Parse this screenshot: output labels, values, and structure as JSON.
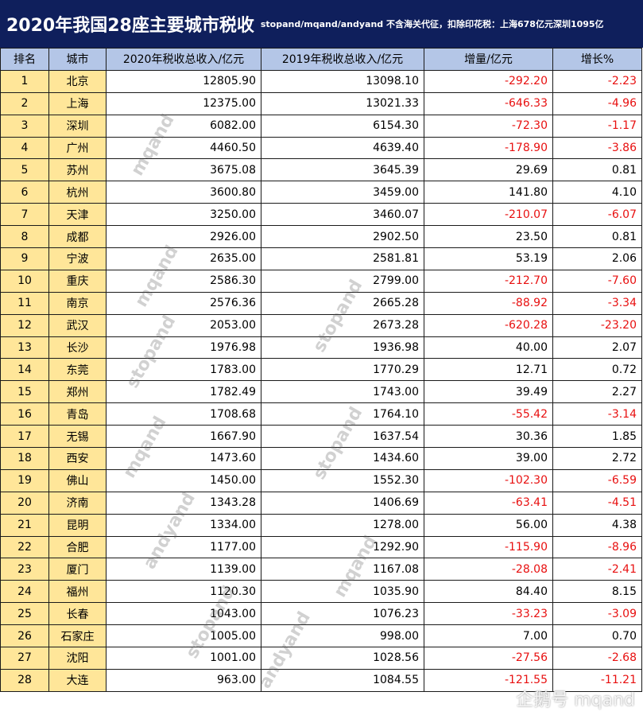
{
  "header": {
    "title": "2020年我国28座主要城市税收",
    "subtitle": "stopand/mqand/andyand 不含海关代征，扣除印花税：上海678亿元深圳1095亿"
  },
  "columns": [
    "排名",
    "城市",
    "2020年税收总收入/亿元",
    "2019年税收总收入/亿元",
    "增量/亿元",
    "增长%"
  ],
  "rows": [
    {
      "rank": "1",
      "city": "北京",
      "y2020": "12805.90",
      "y2019": "13098.10",
      "delta": "-292.20",
      "growth": "-2.23"
    },
    {
      "rank": "2",
      "city": "上海",
      "y2020": "12375.00",
      "y2019": "13021.33",
      "delta": "-646.33",
      "growth": "-4.96"
    },
    {
      "rank": "3",
      "city": "深圳",
      "y2020": "6082.00",
      "y2019": "6154.30",
      "delta": "-72.30",
      "growth": "-1.17"
    },
    {
      "rank": "4",
      "city": "广州",
      "y2020": "4460.50",
      "y2019": "4639.40",
      "delta": "-178.90",
      "growth": "-3.86"
    },
    {
      "rank": "5",
      "city": "苏州",
      "y2020": "3675.08",
      "y2019": "3645.39",
      "delta": "29.69",
      "growth": "0.81"
    },
    {
      "rank": "6",
      "city": "杭州",
      "y2020": "3600.80",
      "y2019": "3459.00",
      "delta": "141.80",
      "growth": "4.10"
    },
    {
      "rank": "7",
      "city": "天津",
      "y2020": "3250.00",
      "y2019": "3460.07",
      "delta": "-210.07",
      "growth": "-6.07"
    },
    {
      "rank": "8",
      "city": "成都",
      "y2020": "2926.00",
      "y2019": "2902.50",
      "delta": "23.50",
      "growth": "0.81"
    },
    {
      "rank": "9",
      "city": "宁波",
      "y2020": "2635.00",
      "y2019": "2581.81",
      "delta": "53.19",
      "growth": "2.06"
    },
    {
      "rank": "10",
      "city": "重庆",
      "y2020": "2586.30",
      "y2019": "2799.00",
      "delta": "-212.70",
      "growth": "-7.60"
    },
    {
      "rank": "11",
      "city": "南京",
      "y2020": "2576.36",
      "y2019": "2665.28",
      "delta": "-88.92",
      "growth": "-3.34"
    },
    {
      "rank": "12",
      "city": "武汉",
      "y2020": "2053.00",
      "y2019": "2673.28",
      "delta": "-620.28",
      "growth": "-23.20"
    },
    {
      "rank": "13",
      "city": "长沙",
      "y2020": "1976.98",
      "y2019": "1936.98",
      "delta": "40.00",
      "growth": "2.07"
    },
    {
      "rank": "14",
      "city": "东莞",
      "y2020": "1783.00",
      "y2019": "1770.29",
      "delta": "12.71",
      "growth": "0.72"
    },
    {
      "rank": "15",
      "city": "郑州",
      "y2020": "1782.49",
      "y2019": "1743.00",
      "delta": "39.49",
      "growth": "2.27"
    },
    {
      "rank": "16",
      "city": "青岛",
      "y2020": "1708.68",
      "y2019": "1764.10",
      "delta": "-55.42",
      "growth": "-3.14"
    },
    {
      "rank": "17",
      "city": "无锡",
      "y2020": "1667.90",
      "y2019": "1637.54",
      "delta": "30.36",
      "growth": "1.85"
    },
    {
      "rank": "18",
      "city": "西安",
      "y2020": "1473.60",
      "y2019": "1434.60",
      "delta": "39.00",
      "growth": "2.72"
    },
    {
      "rank": "19",
      "city": "佛山",
      "y2020": "1450.00",
      "y2019": "1552.30",
      "delta": "-102.30",
      "growth": "-6.59"
    },
    {
      "rank": "20",
      "city": "济南",
      "y2020": "1343.28",
      "y2019": "1406.69",
      "delta": "-63.41",
      "growth": "-4.51"
    },
    {
      "rank": "21",
      "city": "昆明",
      "y2020": "1334.00",
      "y2019": "1278.00",
      "delta": "56.00",
      "growth": "4.38"
    },
    {
      "rank": "22",
      "city": "合肥",
      "y2020": "1177.00",
      "y2019": "1292.90",
      "delta": "-115.90",
      "growth": "-8.96"
    },
    {
      "rank": "23",
      "city": "厦门",
      "y2020": "1139.00",
      "y2019": "1167.08",
      "delta": "-28.08",
      "growth": "-2.41"
    },
    {
      "rank": "24",
      "city": "福州",
      "y2020": "1120.30",
      "y2019": "1035.90",
      "delta": "84.40",
      "growth": "8.15"
    },
    {
      "rank": "25",
      "city": "长春",
      "y2020": "1043.00",
      "y2019": "1076.23",
      "delta": "-33.23",
      "growth": "-3.09"
    },
    {
      "rank": "26",
      "city": "石家庄",
      "y2020": "1005.00",
      "y2019": "998.00",
      "delta": "7.00",
      "growth": "0.70"
    },
    {
      "rank": "27",
      "city": "沈阳",
      "y2020": "1001.00",
      "y2019": "1028.56",
      "delta": "-27.56",
      "growth": "-2.68"
    },
    {
      "rank": "28",
      "city": "大连",
      "y2020": "963.00",
      "y2019": "1084.55",
      "delta": "-121.55",
      "growth": "-11.21"
    }
  ],
  "watermarks": [
    "mqand",
    "mqand",
    "stopand",
    "stopand",
    "mqand",
    "stopand",
    "andyand",
    "mqand",
    "stopand",
    "andyand"
  ],
  "corner_mark": "企鹅号 mqand",
  "colors": {
    "banner_bg": "#0f1f5c",
    "header_bg": "#b4c6e7",
    "rank_city_bg": "#ffe699",
    "negative_text": "#e81010"
  }
}
